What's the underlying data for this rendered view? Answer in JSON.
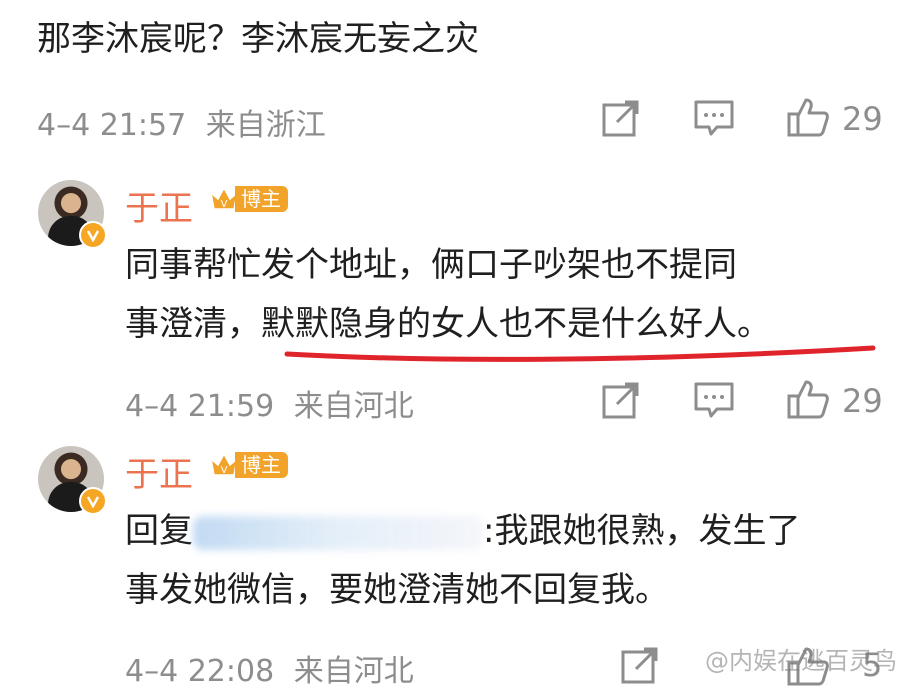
{
  "comment1": {
    "text": "那李沐宸呢？李沐宸无妄之灾",
    "time": "4–4 21:57",
    "source": "来自浙江",
    "likes": "29",
    "icons": [
      "share-icon",
      "comment-icon",
      "like-icon"
    ]
  },
  "reply1": {
    "username": "于正",
    "badge": "博主",
    "text_line1": "同事帮忙发个地址，俩口子吵架也不提同",
    "text_line2_plain": "事澄清，",
    "text_line2_underlined": "默默隐身的女人也不是什么好人。",
    "underline_color": "#e0242b",
    "time": "4–4 21:59",
    "source": "来自河北",
    "likes": "29"
  },
  "reply2": {
    "username": "于正",
    "badge": "博主",
    "reply_prefix": "回复",
    "text_line1_suffix": ":我跟她很熟，发生了",
    "text_line2": "事发她微信，要她澄清她不回复我。",
    "time": "4–4 22:08",
    "source": "来自河北",
    "likes": "5"
  },
  "watermark": "@内娱在逃百灵鸟",
  "colors": {
    "username": "#eb7350",
    "badge": "#f2a32a",
    "meta": "#8d8d8d"
  }
}
